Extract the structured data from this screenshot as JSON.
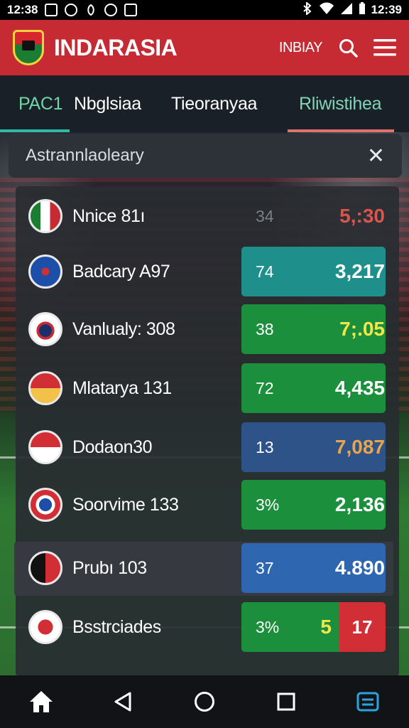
{
  "status_bar": {
    "time_left": "12:38",
    "time_right": "12:39"
  },
  "app": {
    "title": "INDARASIA",
    "today_label": "INBIAY"
  },
  "tabs": [
    {
      "label": "PAC1",
      "active": true,
      "underline": "#2fb9a6"
    },
    {
      "label": "Nbglsiaa",
      "active": false,
      "underline": ""
    },
    {
      "label": "Tieoranyaa",
      "active": false,
      "underline": ""
    },
    {
      "label": "Rliwistihea",
      "active": false,
      "underline": "#e0716c"
    }
  ],
  "panel": {
    "title": "Astrannlaoleary",
    "close_icon": "close-icon"
  },
  "rows": [
    {
      "name": "Nnice 81ı",
      "num1": "34",
      "num2": "5,:30",
      "stat_color": "",
      "num2_color": "#d9544f",
      "num1_color": "#7c8087",
      "badge": "mexico-flag-badge"
    },
    {
      "name": "Badcary A97",
      "num1": "74",
      "num2": "3,217",
      "stat_color": "#1f8f8c",
      "num2_color": "#ffffff",
      "num1_color": "#ffffff",
      "badge": "blue-bird-badge"
    },
    {
      "name": "Vanlualy: 308",
      "num1": "38",
      "num2": "7;.05",
      "stat_color": "#1c8f3d",
      "num2_color": "#f1e64a",
      "num1_color": "#ffffff",
      "badge": "shield-crest-badge"
    },
    {
      "name": "Mlatarya 131",
      "num1": "72",
      "num2": "4,435",
      "stat_color": "#1c8f3d",
      "num2_color": "#ffffff",
      "num1_color": "#ffffff",
      "badge": "red-shield-badge"
    },
    {
      "name": "Dodaon30",
      "num1": "13",
      "num2": "7,087",
      "stat_color": "#2e5389",
      "num2_color": "#e8a54b",
      "num1_color": "#ffffff",
      "badge": "red-white-badge"
    },
    {
      "name": "Soorvime 133",
      "num1": "3%",
      "num2": "2,136",
      "stat_color": "#1c8f3d",
      "num2_color": "#ffffff",
      "num1_color": "#ffffff",
      "badge": "ring-crest-badge"
    },
    {
      "name": "Prubı 103",
      "num1": "37",
      "num2": "4.890",
      "stat_color": "#2e66b0",
      "num2_color": "#ffffff",
      "num1_color": "#ffffff",
      "badge": "dark-shield-badge"
    },
    {
      "name": "Bsstrciades",
      "num1": "3%",
      "num2": "5",
      "stat_color": "#1c8f3d",
      "num2_color": "#f1e64a",
      "num1_color": "#ffffff",
      "red_chip": "17",
      "badge": "round-crest-badge"
    }
  ],
  "nav": {
    "home_icon": "home-icon",
    "back_icon": "back-icon",
    "circle_icon": "home-circle-icon",
    "recent_icon": "recent-apps-icon",
    "menu_icon": "menu-app-icon"
  }
}
